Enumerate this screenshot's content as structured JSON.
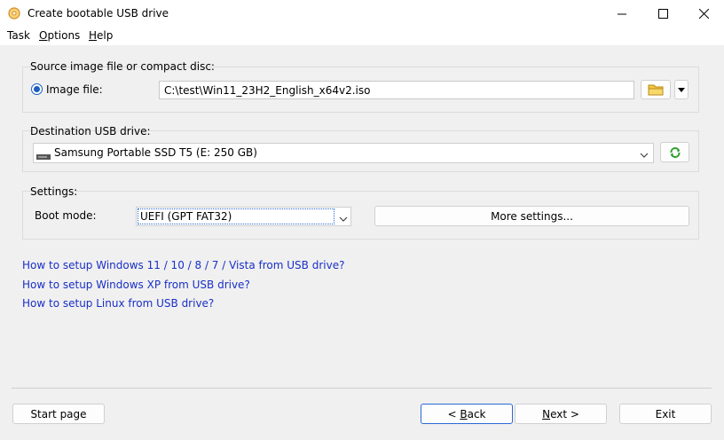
{
  "window": {
    "title": "Create bootable USB drive"
  },
  "menu": [
    {
      "pre": "",
      "accel": "",
      "post": "Task"
    },
    {
      "pre": "",
      "accel": "O",
      "post": "ptions"
    },
    {
      "pre": "",
      "accel": "H",
      "post": "elp"
    }
  ],
  "source": {
    "group_label": "Source image file or compact disc:",
    "radio_label": "Image file:",
    "path_value": "C:\\test\\Win11_23H2_English_x64v2.iso"
  },
  "destination": {
    "group_label": "Destination USB drive:",
    "drive_value": "Samsung Portable SSD T5 (E:  250 GB)"
  },
  "settings": {
    "group_label": "Settings:",
    "boot_label": "Boot mode:",
    "boot_value": "UEFI (GPT FAT32)",
    "more_button": "More settings..."
  },
  "links": [
    "How to setup Windows 11 / 10 / 8 / 7 / Vista from USB drive?",
    "How to setup Windows XP from USB drive?",
    "How to setup Linux from USB drive?"
  ],
  "footer": {
    "start_page": "Start page",
    "back_pre": "< ",
    "back_accel": "B",
    "back_post": "ack",
    "next_accel": "N",
    "next_post": "ext >",
    "exit": "Exit"
  },
  "colors": {
    "link": "#1a2fc7",
    "radio_accent": "#1b5fbf",
    "focus": "#2a6ad6"
  },
  "icons": [
    "app-disc-icon",
    "minimize-icon",
    "maximize-icon",
    "close-icon",
    "folder-icon",
    "dropdown-arrow-icon",
    "usb-drive-icon",
    "chevron-down-icon",
    "refresh-icon"
  ]
}
